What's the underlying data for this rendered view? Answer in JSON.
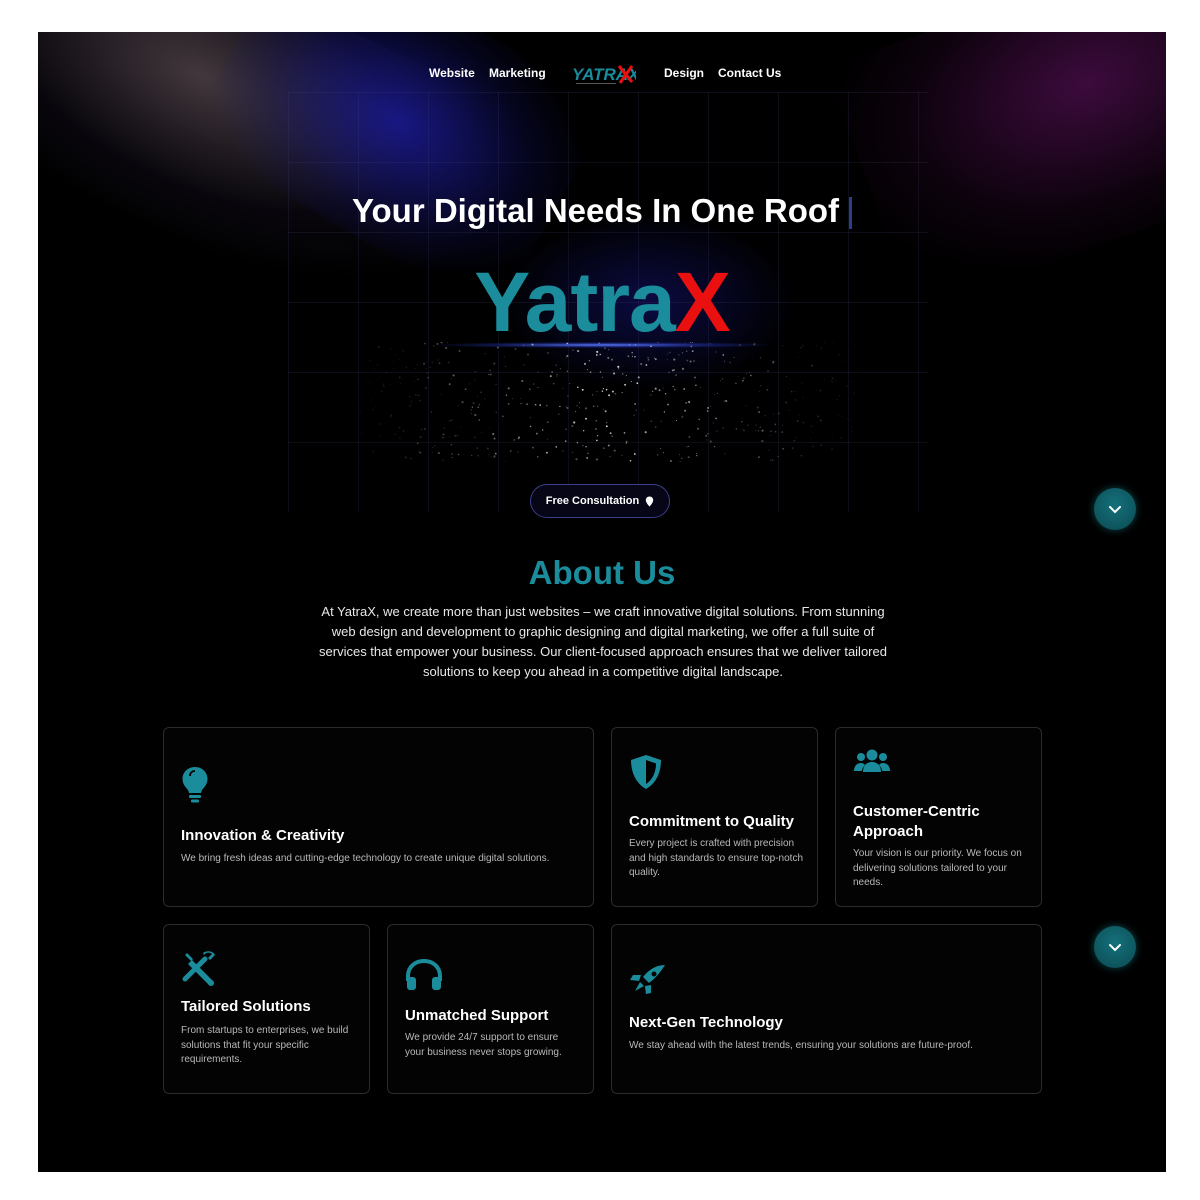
{
  "nav": {
    "links_left": [
      "Website",
      "Marketing"
    ],
    "links_right": [
      "Design",
      "Contact Us"
    ],
    "logo_text": "YATRAX"
  },
  "hero": {
    "title": "Your Digital Needs In One Roof",
    "brand_part1": "Yatra",
    "brand_part2": "X",
    "cta_label": "Free Consultation"
  },
  "about": {
    "title": "About Us",
    "text": "At YatraX, we create more than just websites – we craft innovative digital solutions. From stunning web design and development to graphic designing and digital marketing, we offer a full suite of services that empower your business. Our client-focused approach ensures that we deliver tailored solutions to keep you ahead in a competitive digital landscape."
  },
  "features": [
    {
      "icon": "lightbulb-icon",
      "title": "Innovation & Creativity",
      "desc": "We bring fresh ideas and cutting-edge technology to create unique digital solutions."
    },
    {
      "icon": "shield-icon",
      "title": "Commitment to Quality",
      "desc": "Every project is crafted with precision and high standards to ensure top-notch quality."
    },
    {
      "icon": "users-icon",
      "title": "Customer-Centric Approach",
      "desc": "Your vision is our priority. We focus on delivering solutions tailored to your needs."
    },
    {
      "icon": "tools-icon",
      "title": "Tailored Solutions",
      "desc": "From startups to enterprises, we build solutions that fit your specific requirements."
    },
    {
      "icon": "headphones-icon",
      "title": "Unmatched Support",
      "desc": "We provide 24/7 support to ensure your business never stops growing."
    },
    {
      "icon": "rocket-icon",
      "title": "Next-Gen Technology",
      "desc": "We stay ahead with the latest trends, ensuring your solutions are future-proof."
    }
  ],
  "colors": {
    "teal": "#1a8c9c",
    "red": "#ea1010",
    "background": "#000000"
  }
}
